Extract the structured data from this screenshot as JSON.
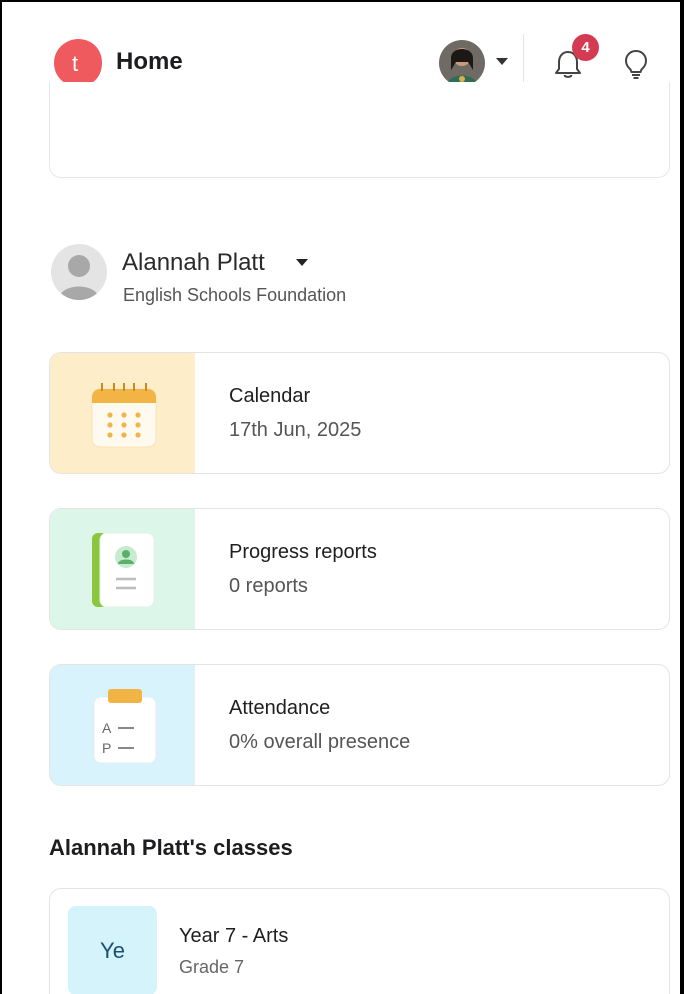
{
  "header": {
    "title": "Home",
    "logo_letter": "t",
    "notifications_count": "4",
    "icons": [
      "avatar",
      "chevron-down-icon",
      "bell-icon",
      "lightbulb-icon"
    ]
  },
  "profile": {
    "name": "Alannah Platt",
    "organization": "English Schools Foundation"
  },
  "cards": {
    "calendar": {
      "title": "Calendar",
      "subtitle": "17th Jun, 2025"
    },
    "progress": {
      "title": "Progress reports",
      "subtitle": "0 reports"
    },
    "attendance": {
      "title": "Attendance",
      "subtitle": "0% overall presence",
      "icon_letters": [
        "A",
        "P"
      ]
    }
  },
  "classes": {
    "heading": "Alannah Platt's classes",
    "items": [
      {
        "abbr": "Ye",
        "title": "Year 7 - Arts",
        "subtitle": "Grade 7"
      }
    ]
  },
  "colors": {
    "brand": "#ef5a5f",
    "badge": "#d43a52",
    "calendar_tile": "#fdedc9",
    "progress_tile": "#dcf7ea",
    "attendance_tile": "#d8f3fb",
    "class_tile": "#d4f3fb"
  }
}
